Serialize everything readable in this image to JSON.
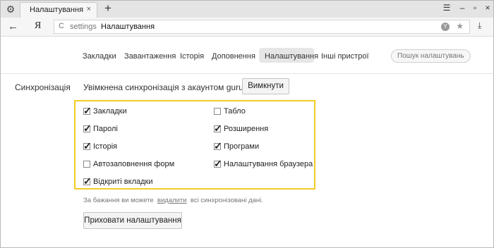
{
  "tab": {
    "title": "Налаштування",
    "close": "×"
  },
  "tabstrip": {
    "new_tab": "+",
    "menu": "☰",
    "minimize": "–",
    "restore": "▫",
    "close": "×"
  },
  "toolbar": {
    "back": "←",
    "ya": "Я",
    "reload": "C",
    "url_scheme": "settings",
    "url_title": "Налаштування",
    "ext": "Y",
    "star": "★",
    "download": "⤓"
  },
  "nav": {
    "items": [
      "Закладки",
      "Завантаження",
      "Історія",
      "Доповнення",
      "Налаштування",
      "Інші пристрої"
    ],
    "active": "Налаштування",
    "search_placeholder": "Пошук налаштувань"
  },
  "sync": {
    "section_label": "Синхронізація",
    "status": "Увімкнена синхронізація з акаунтом guru",
    "disable_button": "Вимкнути",
    "options": [
      {
        "label": "Закладки",
        "checked": true
      },
      {
        "label": "Табло",
        "checked": false
      },
      {
        "label": "Паролі",
        "checked": true
      },
      {
        "label": "Розширення",
        "checked": true
      },
      {
        "label": "Історія",
        "checked": true
      },
      {
        "label": "Програми",
        "checked": true
      },
      {
        "label": "Автозаповнення форм",
        "checked": false
      },
      {
        "label": "Налаштування браузера",
        "checked": true
      },
      {
        "label": "Відкриті вкладки",
        "checked": true
      }
    ],
    "note_before": "За бажання ви можете",
    "note_link": "видалити",
    "note_after": "всі синхронізовані дані.",
    "hide_button": "Приховати налаштування",
    "highlight_color": "#f2cc26"
  }
}
